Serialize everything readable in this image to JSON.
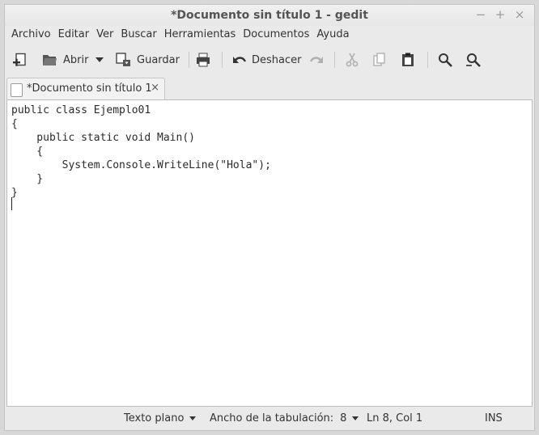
{
  "window": {
    "title": "*Documento sin título 1 - gedit",
    "minimize": "−",
    "maximize": "+",
    "close": "×"
  },
  "menubar": [
    "Archivo",
    "Editar",
    "Ver",
    "Buscar",
    "Herramientas",
    "Documentos",
    "Ayuda"
  ],
  "toolbar": {
    "new_icon": "new-document-icon",
    "open_label": "Abrir",
    "save_label": "Guardar",
    "print_icon": "print-icon",
    "undo_label": "Deshacer",
    "redo_icon": "redo-icon",
    "cut_icon": "cut-icon",
    "copy_icon": "copy-icon",
    "paste_icon": "paste-icon",
    "find_icon": "search-icon",
    "replace_icon": "search-replace-icon"
  },
  "tab": {
    "label": "*Documento sin título 1",
    "close": "×"
  },
  "editor": {
    "lines": [
      "public class Ejemplo01",
      "{",
      "    public static void Main()",
      "    {",
      "        System.Console.WriteLine(\"Hola\");",
      "    }",
      "}",
      ""
    ]
  },
  "statusbar": {
    "language": "Texto plano",
    "tab_width_label": "Ancho de la tabulación:",
    "tab_width_value": "8",
    "position": "Ln 8, Col 1",
    "mode": "INS"
  },
  "colors": {
    "window_bg": "#eaeaea",
    "editor_bg": "#ffffff",
    "disabled_icon": "#b0b0b0"
  }
}
